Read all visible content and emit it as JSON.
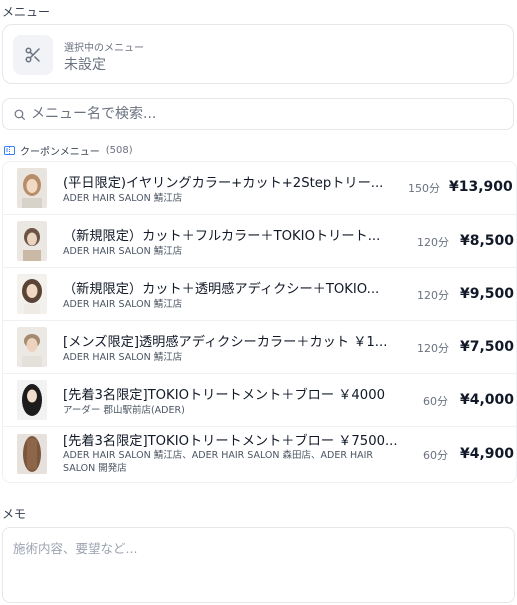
{
  "menu_section": {
    "label": "メニュー",
    "selected_caption": "選択中のメニュー",
    "selected_value": "未設定"
  },
  "search": {
    "placeholder": "メニュー名で検索..."
  },
  "coupon_section": {
    "label": "クーポンメニュー",
    "count": "(508)"
  },
  "menu_items": [
    {
      "title": "(平日限定)イヤリングカラー+カット+2Stepトリー...",
      "salon": "ADER HAIR SALON 鯖江店",
      "duration": "150分",
      "price": "¥13,900"
    },
    {
      "title": "（新規限定）カット＋フルカラー＋TOKIOトリート...",
      "salon": "ADER HAIR SALON 鯖江店",
      "duration": "120分",
      "price": "¥8,500"
    },
    {
      "title": "（新規限定）カット＋透明感アディクシー＋TOKIO...",
      "salon": "ADER HAIR SALON 鯖江店",
      "duration": "120分",
      "price": "¥9,500"
    },
    {
      "title": "[メンズ限定]透明感アディクシーカラー＋カット ￥1...",
      "salon": "ADER HAIR SALON 鯖江店",
      "duration": "120分",
      "price": "¥7,500"
    },
    {
      "title": "[先着3名限定]TOKIOトリートメント＋ブロー ￥4000",
      "salon": "アーダー 郡山駅前店(ADER)",
      "duration": "60分",
      "price": "¥4,000"
    },
    {
      "title": "[先着3名限定]TOKIOトリートメント＋ブロー ￥7500...",
      "salon": "ADER HAIR SALON 鯖江店、ADER HAIR SALON 森田店、ADER HAIR SALON 開発店",
      "duration": "60分",
      "price": "¥4,900"
    }
  ],
  "memo_section": {
    "label": "メモ",
    "placeholder": "施術内容、要望など..."
  },
  "colors": {
    "border": "#e5e7eb",
    "muted_text": "#6b7280",
    "icon_bg": "#f1f3f6",
    "accent_icon": "#3b82f6"
  }
}
